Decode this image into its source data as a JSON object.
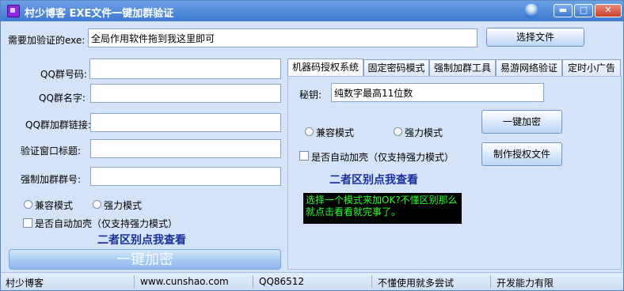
{
  "window": {
    "title": "村少博客  EXE文件一键加群验证",
    "buttons": {
      "minimize": "▬",
      "maximize": "□",
      "close": "✕"
    }
  },
  "top": {
    "exe_label": "需要加验证的exe:",
    "exe_value": "全局作用软件拖到我这里即可",
    "select_button": "选择文件"
  },
  "left": {
    "fields": [
      {
        "label": "QQ群号码:",
        "value": ""
      },
      {
        "label": "QQ群名字:",
        "value": ""
      },
      {
        "label": "QQ群加群链接:",
        "value": ""
      },
      {
        "label": "验证窗口标题:",
        "value": ""
      },
      {
        "label": "强制加群群号:",
        "value": ""
      }
    ],
    "radio_compat": "兼容模式",
    "radio_strong": "强力模式",
    "checkbox_pack": "是否自动加壳（仅支持强力模式）",
    "note": "二者区别点我查看",
    "encrypt_button": "一键加密"
  },
  "tabs": [
    {
      "label": "机器码授权系统",
      "active": true
    },
    {
      "label": "固定密码模式",
      "active": false
    },
    {
      "label": "强制加群工具",
      "active": false
    },
    {
      "label": "易游网络验证",
      "active": false
    },
    {
      "label": "定时小广告",
      "active": false
    }
  ],
  "panel": {
    "key_label": "秘钥:",
    "key_value": "纯数字最高11位数",
    "radio_compat": "兼容模式",
    "radio_strong": "强力模式",
    "checkbox_pack": "是否自动加壳（仅支持强力模式）",
    "note": "二者区别点我查看",
    "encrypt_button": "一键加密",
    "make_license_button": "制作授权文件",
    "console_text": "选择一个模式来加OK?不懂区别那么就点击看看就完事了。"
  },
  "statusbar": {
    "items": [
      "村少博客",
      "www.cunshao.com",
      "QQ86512",
      "不懂使用就多尝试",
      "开发能力有限"
    ]
  },
  "colors": {
    "titlebar": "#3f7ad0",
    "background": "#d4e3f7",
    "console_text": "#2bff2b",
    "note": "#1b2fa0"
  }
}
